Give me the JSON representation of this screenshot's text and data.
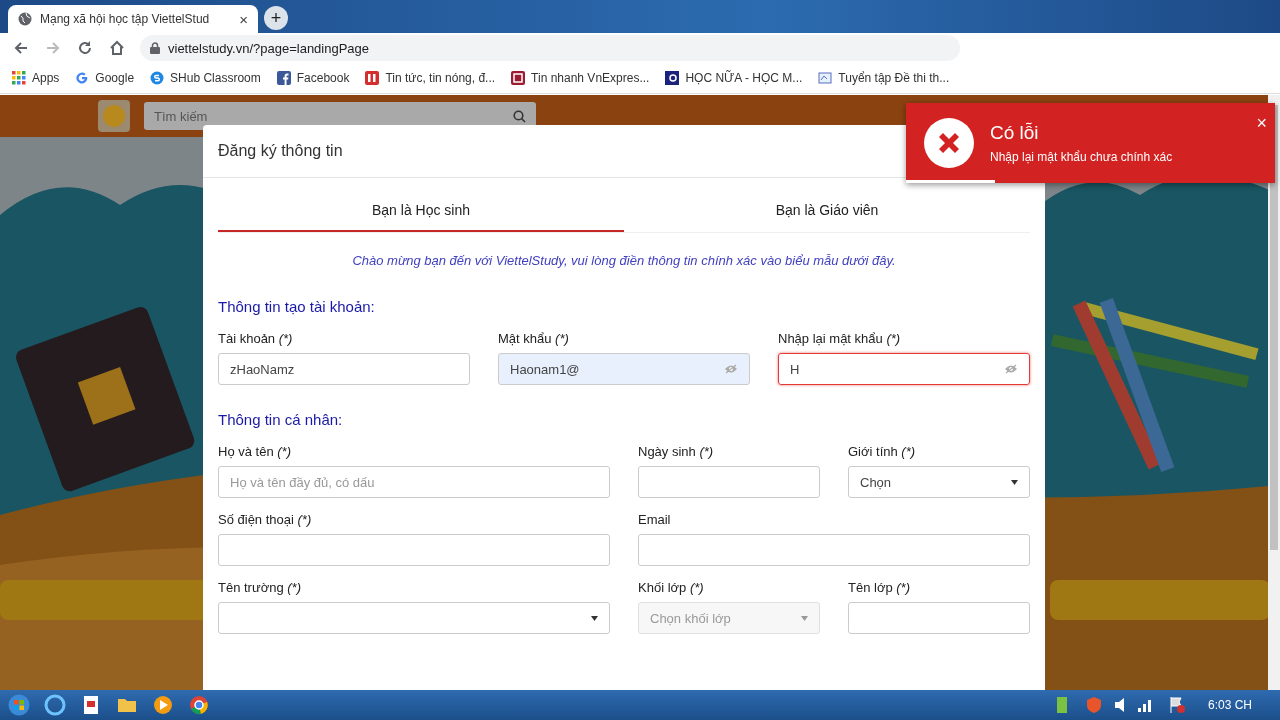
{
  "browser": {
    "tab": {
      "title": "Mạng xã hội học tập ViettelStud",
      "close": "×"
    },
    "new_tab": "+",
    "address": "viettelstudy.vn/?page=landingPage",
    "bookmarks": [
      {
        "label": "Apps"
      },
      {
        "label": "Google"
      },
      {
        "label": "SHub Classroom"
      },
      {
        "label": "Facebook"
      },
      {
        "label": "Tin tức, tin nóng, đ..."
      },
      {
        "label": "Tin nhanh VnExpres..."
      },
      {
        "label": "HỌC NỮA - HỌC M..."
      },
      {
        "label": "Tuyển tập Đề thi th..."
      }
    ]
  },
  "site_header": {
    "search": {
      "placeholder": "Tìm kiếm"
    }
  },
  "modal": {
    "title": "Đăng ký thông tin",
    "tabs": [
      {
        "label": "Bạn là Học sinh",
        "selected": true
      },
      {
        "label": "Bạn là Giáo viên",
        "selected": false
      }
    ],
    "intro": "Chào mừng bạn đến với ViettelStudy, vui lòng điền thông tin chính xác vào biểu mẫu dưới đây.",
    "sections": [
      {
        "title": "Thông tin tạo tài khoản:",
        "rows": [
          [
            {
              "label": "Tài khoản",
              "required_mark": "(*)",
              "kind": "text",
              "value": "zHaoNamz"
            },
            {
              "label": "Mật khẩu",
              "required_mark": "(*)",
              "kind": "password",
              "value": "Haonam1@",
              "autofilled": true
            },
            {
              "label": "Nhập lại mật khẩu",
              "required_mark": "(*)",
              "kind": "password",
              "value": "H",
              "error": true
            }
          ]
        ]
      },
      {
        "title": "Thông tin cá nhân:",
        "rows": [
          [
            {
              "label": "Họ và tên",
              "required_mark": "(*)",
              "kind": "text",
              "placeholder": "Họ và tên đầy đủ, có dấu"
            },
            {
              "label": "Ngày sinh",
              "required_mark": "(*)",
              "kind": "text"
            },
            {
              "label": "Giới tính",
              "required_mark": "(*)",
              "kind": "select",
              "value": "Chọn"
            }
          ],
          [
            {
              "label": "Số điện thoại",
              "required_mark": "(*)",
              "kind": "text"
            },
            {
              "label": "Email",
              "kind": "text"
            }
          ],
          [
            {
              "label": "Tên trường",
              "required_mark": "(*)",
              "kind": "select"
            },
            {
              "label": "Khối lớp",
              "required_mark": "(*)",
              "kind": "select",
              "placeholder": "Chọn khối lớp",
              "disabled": true
            },
            {
              "label": "Tên lớp",
              "required_mark": "(*)",
              "kind": "text"
            }
          ]
        ]
      }
    ]
  },
  "toast": {
    "title": "Có lỗi",
    "message": "Nhập lại mật khẩu chưa chính xác",
    "close": "×",
    "level": 0.24
  },
  "taskbar": {
    "clock": "6:03 CH"
  }
}
